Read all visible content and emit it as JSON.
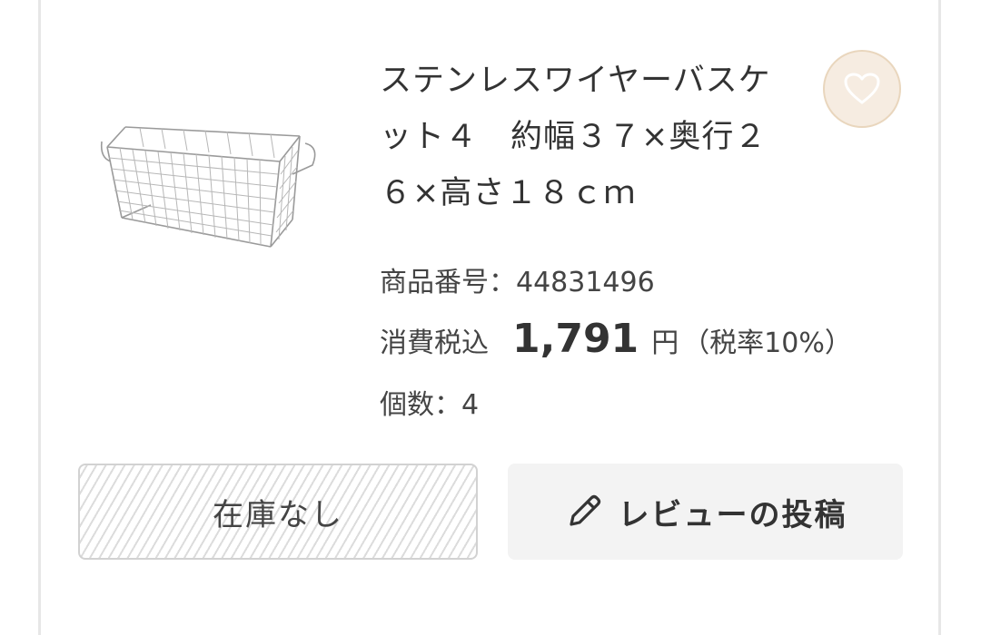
{
  "product": {
    "title": "ステンレスワイヤーバスケット４　約幅３７×奥行２６×高さ１８ｃｍ",
    "code_label": "商品番号：",
    "code": "44831496",
    "price_prefix": "消費税込",
    "price": "1,791",
    "price_unit": "円",
    "tax_note": "（税率10%）",
    "qty_label": "個数：",
    "qty": "4",
    "image_icon": "wire-basket-image"
  },
  "actions": {
    "out_of_stock_label": "在庫なし",
    "review_label": "レビューの投稿",
    "review_icon": "pencil-icon",
    "favorite_icon": "heart-icon"
  },
  "colors": {
    "favorite_bg": "#f6ece1",
    "favorite_border": "#e9d6bd",
    "review_bg": "#f3f3f3"
  }
}
